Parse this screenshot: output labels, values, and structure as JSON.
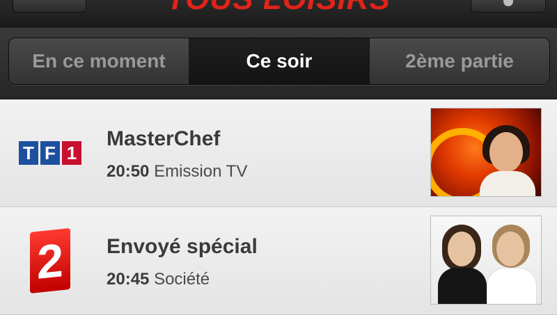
{
  "header": {
    "logo_text": "TOUS LOISIRS",
    "left_button_icon": "back-button-icon",
    "right_button_icon": "settings-icon",
    "brand_color": "#e2231a"
  },
  "tabs": [
    {
      "label": "En ce moment",
      "active": false
    },
    {
      "label": "Ce soir",
      "active": true
    },
    {
      "label": "2ème partie",
      "active": false
    }
  ],
  "programs": [
    {
      "channel": "TF1",
      "channel_letters": [
        "T",
        "F",
        "1"
      ],
      "title": "MasterChef",
      "time": "20:50",
      "genre": "Emission TV",
      "thumbnail": "masterchef-thumbnail"
    },
    {
      "channel": "France 2",
      "channel_mark": "2",
      "title": "Envoyé spécial",
      "time": "20:45",
      "genre": "Société",
      "thumbnail": "envoye-special-thumbnail"
    }
  ]
}
